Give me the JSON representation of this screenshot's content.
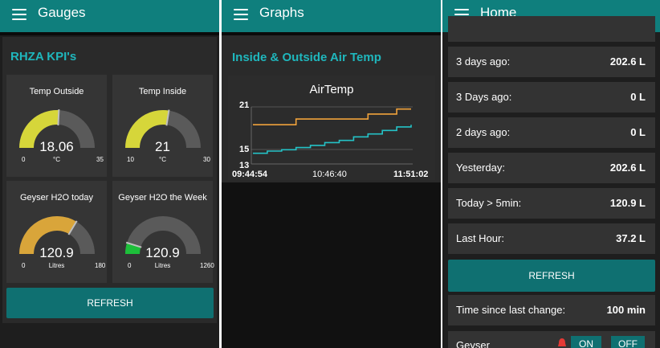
{
  "colors": {
    "appbar": "#0f7f7d",
    "accent": "#1fb7bd",
    "button": "#0f7071",
    "gauge_yellow": "#d6d63a",
    "gauge_orange": "#d9a53a",
    "gauge_green": "#1dbf3a",
    "series_outside": "#f0a23b",
    "series_inside": "#24c2c6"
  },
  "screens": {
    "gauges": {
      "title": "Gauges",
      "menu_icon": "hamburger-menu-icon",
      "section_title": "RHZA KPI's",
      "gauges": [
        {
          "title": "Temp Outside",
          "value": "18.06",
          "unit": "°C",
          "min": "0",
          "max": "35",
          "fraction": 0.516
        },
        {
          "title": "Temp Inside",
          "value": "21",
          "unit": "°C",
          "min": "10",
          "max": "30",
          "fraction": 0.55
        },
        {
          "title": "Geyser H2O today",
          "value": "120.9",
          "unit": "Litres",
          "min": "0",
          "max": "180",
          "fraction": 0.672
        },
        {
          "title": "Geyser H2O the Week",
          "value": "120.9",
          "unit": "Litres",
          "min": "0",
          "max": "1260",
          "fraction": 0.096
        }
      ],
      "refresh_label": "REFRESH"
    },
    "graphs": {
      "title": "Graphs",
      "menu_icon": "hamburger-menu-icon",
      "section_title": "Inside & Outside Air Temp",
      "chart_title": "AirTemp",
      "y_ticks": [
        "21",
        "15",
        "13"
      ],
      "x_ticks": [
        "09:44:54",
        "10:46:40",
        "11:51:02"
      ]
    },
    "home": {
      "title": "Home",
      "menu_icon": "hamburger-menu-icon",
      "rows": [
        {
          "label": "3 days ago:",
          "value": "202.6 L"
        },
        {
          "label": "3 Days ago:",
          "value": "0 L"
        },
        {
          "label": "2 days ago:",
          "value": "0 L"
        },
        {
          "label": "Yesterday:",
          "value": "202.6 L"
        },
        {
          "label": "Today > 5min:",
          "value": "120.9 L"
        },
        {
          "label": "Last Hour:",
          "value": "37.2 L"
        }
      ],
      "refresh_label": "REFRESH",
      "since_label": "Time since last change:",
      "since_value": "100 min",
      "geyser_label": "Geyser",
      "on_label": "ON",
      "off_label": "OFF"
    }
  },
  "chart_data": {
    "type": "line",
    "title": "AirTemp",
    "x": [
      "09:44:54",
      "10:46:40",
      "11:51:02"
    ],
    "ylim": [
      13,
      21
    ],
    "y_ticks": [
      21,
      15,
      13
    ],
    "series": [
      {
        "values": [
          18.5,
          18.5,
          18.5,
          19.3,
          19.3,
          19.3,
          19.3,
          19.3,
          20.0,
          20.0,
          20.7,
          20.7
        ]
      },
      {
        "values": [
          14.5,
          14.8,
          15.0,
          15.3,
          15.6,
          16.0,
          16.3,
          16.8,
          17.2,
          17.7,
          18.2,
          18.5
        ]
      }
    ]
  }
}
